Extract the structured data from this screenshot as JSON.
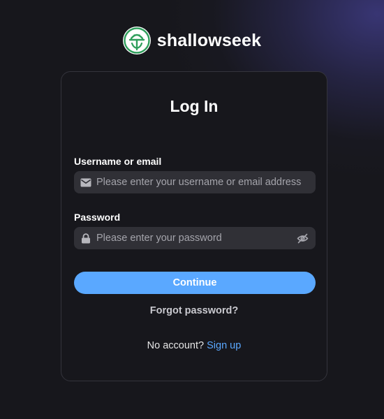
{
  "brand": {
    "name": "shallowseek",
    "logo_icon": "shallowseek-logo",
    "logo_color": "#2e9e5b"
  },
  "login": {
    "title": "Log In",
    "username": {
      "label": "Username or email",
      "placeholder": "Please enter your username or email address",
      "value": "",
      "icon": "mail-icon"
    },
    "password": {
      "label": "Password",
      "placeholder": "Please enter your password",
      "value": "",
      "icon": "lock-icon",
      "toggle_icon": "eye-off-icon"
    },
    "continue_label": "Continue",
    "forgot_label": "Forgot password?",
    "no_account_text": "No account?",
    "signup_label": "Sign up"
  },
  "colors": {
    "accent": "#5aa8ff",
    "background": "#17171c",
    "input_background": "#303036",
    "card_border": "#34343c"
  }
}
